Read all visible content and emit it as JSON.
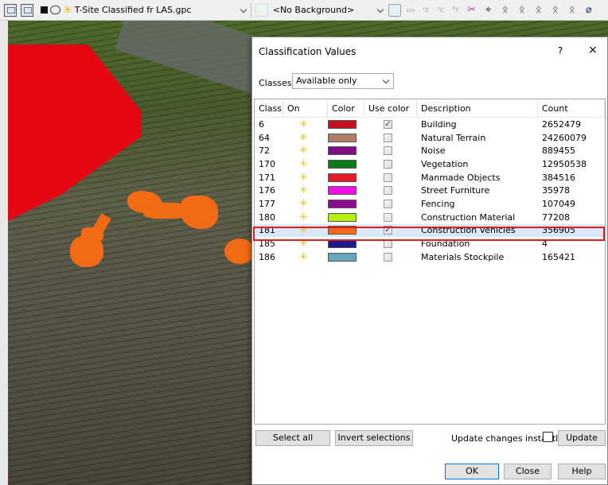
{
  "toolbar": {
    "file_name": "T-Site Classified fr LAS.gpc",
    "background": "<No Background>",
    "icons": [
      "layers-icon",
      "properties-icon",
      "color-square-icon",
      "cloud-icon",
      "classification-spark-icon",
      "background-icon",
      "tool-icons",
      "lasso-icons"
    ]
  },
  "dialog": {
    "title": "Classification Values",
    "help_glyph": "?",
    "close_glyph": "×",
    "classes_label": "Classes",
    "classes_value": "Available only",
    "columns": [
      "Class",
      "On",
      "Color",
      "Use color",
      "Description",
      "Count"
    ],
    "rows": [
      {
        "class": "6",
        "color": "#c8101e",
        "use_color": true,
        "description": "Building",
        "count": "2652479"
      },
      {
        "class": "64",
        "color": "#b07f67",
        "use_color": false,
        "description": "Natural Terrain",
        "count": "24260079"
      },
      {
        "class": "72",
        "color": "#7e0c82",
        "use_color": false,
        "description": "Noise",
        "count": "889455"
      },
      {
        "class": "170",
        "color": "#0a7a18",
        "use_color": false,
        "description": "Vegetation",
        "count": "12950538"
      },
      {
        "class": "171",
        "color": "#e51b2c",
        "use_color": false,
        "description": "Manmade Objects",
        "count": "384516"
      },
      {
        "class": "176",
        "color": "#ee10e6",
        "use_color": false,
        "description": "Street Furniture",
        "count": "35978"
      },
      {
        "class": "177",
        "color": "#8b0c8f",
        "use_color": false,
        "description": "Fencing",
        "count": "107049"
      },
      {
        "class": "180",
        "color": "#b6ee10",
        "use_color": false,
        "description": "Construction Material",
        "count": "77208"
      },
      {
        "class": "181",
        "color": "#f26a14",
        "use_color": true,
        "description": "Construction Vehicles",
        "count": "356905",
        "selected": true
      },
      {
        "class": "185",
        "color": "#1a1a8e",
        "use_color": false,
        "description": "Foundation",
        "count": "4"
      },
      {
        "class": "186",
        "color": "#64a6c0",
        "use_color": false,
        "description": "Materials Stockpile",
        "count": "165421"
      }
    ],
    "buttons": {
      "select_all": "Select all",
      "invert": "Invert selections",
      "update_instantly": "Update changes instantly",
      "update": "Update",
      "ok": "OK",
      "close": "Close",
      "help": "Help"
    }
  },
  "colors": {
    "highlight": "#e01b1b",
    "on_icon": "#f2c200"
  }
}
